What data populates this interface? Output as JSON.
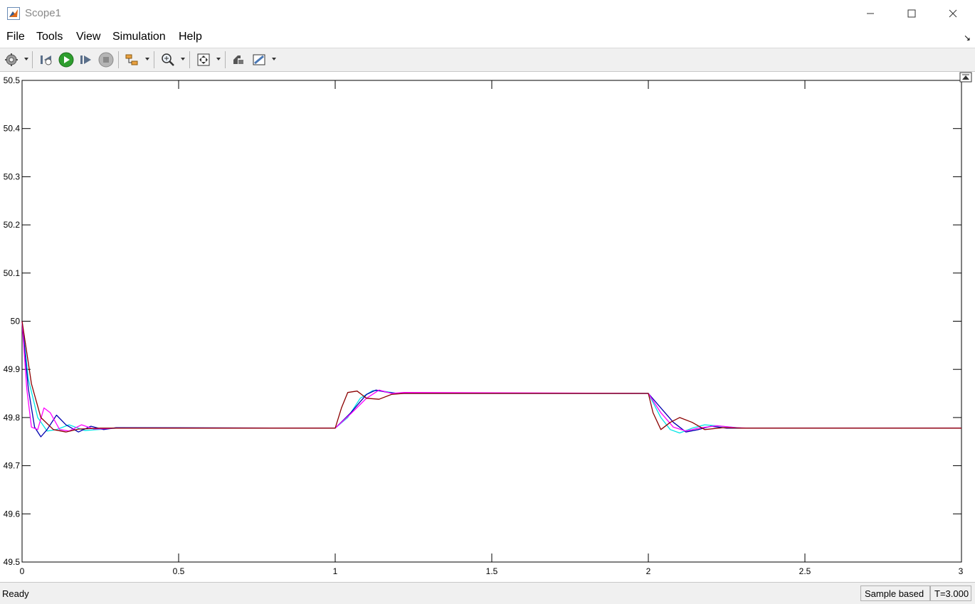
{
  "window": {
    "title": "Scope1",
    "controls": [
      "minimize-icon",
      "maximize-icon",
      "close-icon"
    ]
  },
  "menu": {
    "items": [
      "File",
      "Tools",
      "View",
      "Simulation",
      "Help"
    ]
  },
  "toolbar": {
    "buttons": [
      {
        "icon": "gear-icon",
        "dropdown": true
      },
      {
        "icon": "step-back-icon"
      },
      {
        "icon": "run-icon"
      },
      {
        "icon": "step-forward-icon"
      },
      {
        "icon": "stop-icon"
      },
      {
        "icon": "signal-selector-icon",
        "dropdown": true
      },
      {
        "icon": "zoom-in-icon",
        "dropdown": true
      },
      {
        "icon": "autoscale-icon",
        "dropdown": true
      },
      {
        "icon": "highlight-block-icon"
      },
      {
        "icon": "measurements-icon",
        "dropdown": true
      }
    ]
  },
  "status": {
    "text": "Ready",
    "sample_mode": "Sample based",
    "time": "T=3.000"
  },
  "chart_data": {
    "type": "line",
    "title": "",
    "xlabel": "",
    "ylabel": "",
    "xlim": [
      0,
      3
    ],
    "ylim": [
      49.5,
      50.5
    ],
    "xticks": [
      "0",
      "0.5",
      "1",
      "1.5",
      "2",
      "2.5",
      "3"
    ],
    "yticks": [
      "49.5",
      "49.6",
      "49.7",
      "49.8",
      "49.9",
      "50",
      "50.1",
      "50.2",
      "50.3",
      "50.4",
      "50.5"
    ],
    "grid": false,
    "series": [
      {
        "color": "#00e5e5",
        "x": [
          0,
          0.02,
          0.05,
          0.08,
          0.11,
          0.15,
          0.2,
          0.3,
          1.0,
          1.04,
          1.08,
          1.12,
          1.15,
          1.2,
          2.0,
          2.04,
          2.07,
          2.1,
          2.14,
          2.18,
          2.25,
          2.3,
          3.0
        ],
        "y": [
          50.0,
          49.88,
          49.8,
          49.772,
          49.775,
          49.785,
          49.773,
          49.778,
          49.778,
          49.8,
          49.84,
          49.856,
          49.855,
          49.85,
          49.85,
          49.8,
          49.775,
          49.768,
          49.778,
          49.785,
          49.781,
          49.778,
          49.778
        ]
      },
      {
        "color": "#0000b0",
        "x": [
          0,
          0.02,
          0.04,
          0.06,
          0.08,
          0.11,
          0.14,
          0.18,
          0.22,
          0.26,
          0.3,
          1.0,
          1.05,
          1.1,
          1.13,
          1.17,
          1.2,
          2.0,
          2.04,
          2.08,
          2.12,
          2.16,
          2.2,
          2.25,
          2.3,
          3.0
        ],
        "y": [
          50.0,
          49.86,
          49.78,
          49.76,
          49.775,
          49.805,
          49.785,
          49.77,
          49.782,
          49.775,
          49.779,
          49.778,
          49.81,
          49.848,
          49.857,
          49.852,
          49.85,
          49.85,
          49.82,
          49.79,
          49.77,
          49.775,
          49.782,
          49.778,
          49.778,
          49.778
        ]
      },
      {
        "color": "#ff00ff",
        "x": [
          0,
          0.015,
          0.03,
          0.05,
          0.07,
          0.09,
          0.12,
          0.15,
          0.19,
          0.23,
          0.3,
          1.0,
          1.05,
          1.1,
          1.14,
          1.18,
          1.22,
          2.0,
          2.04,
          2.08,
          2.12,
          2.16,
          2.22,
          2.28,
          2.32,
          3.0
        ],
        "y": [
          50.0,
          49.86,
          49.78,
          49.775,
          49.82,
          49.81,
          49.775,
          49.772,
          49.785,
          49.776,
          49.778,
          49.778,
          49.808,
          49.84,
          49.857,
          49.85,
          49.852,
          49.85,
          49.81,
          49.78,
          49.772,
          49.778,
          49.783,
          49.779,
          49.778,
          49.778
        ]
      },
      {
        "color": "#8b0000",
        "x": [
          0,
          0.03,
          0.06,
          0.1,
          0.14,
          0.18,
          0.25,
          1.0,
          1.02,
          1.04,
          1.07,
          1.1,
          1.14,
          1.18,
          1.22,
          2.0,
          2.015,
          2.04,
          2.07,
          2.1,
          2.14,
          2.18,
          2.24,
          2.3,
          3.0
        ],
        "y": [
          50.0,
          49.87,
          49.8,
          49.775,
          49.77,
          49.776,
          49.778,
          49.778,
          49.82,
          49.852,
          49.855,
          49.84,
          49.838,
          49.848,
          49.85,
          49.85,
          49.81,
          49.775,
          49.79,
          49.8,
          49.79,
          49.775,
          49.779,
          49.778,
          49.778
        ]
      }
    ]
  }
}
